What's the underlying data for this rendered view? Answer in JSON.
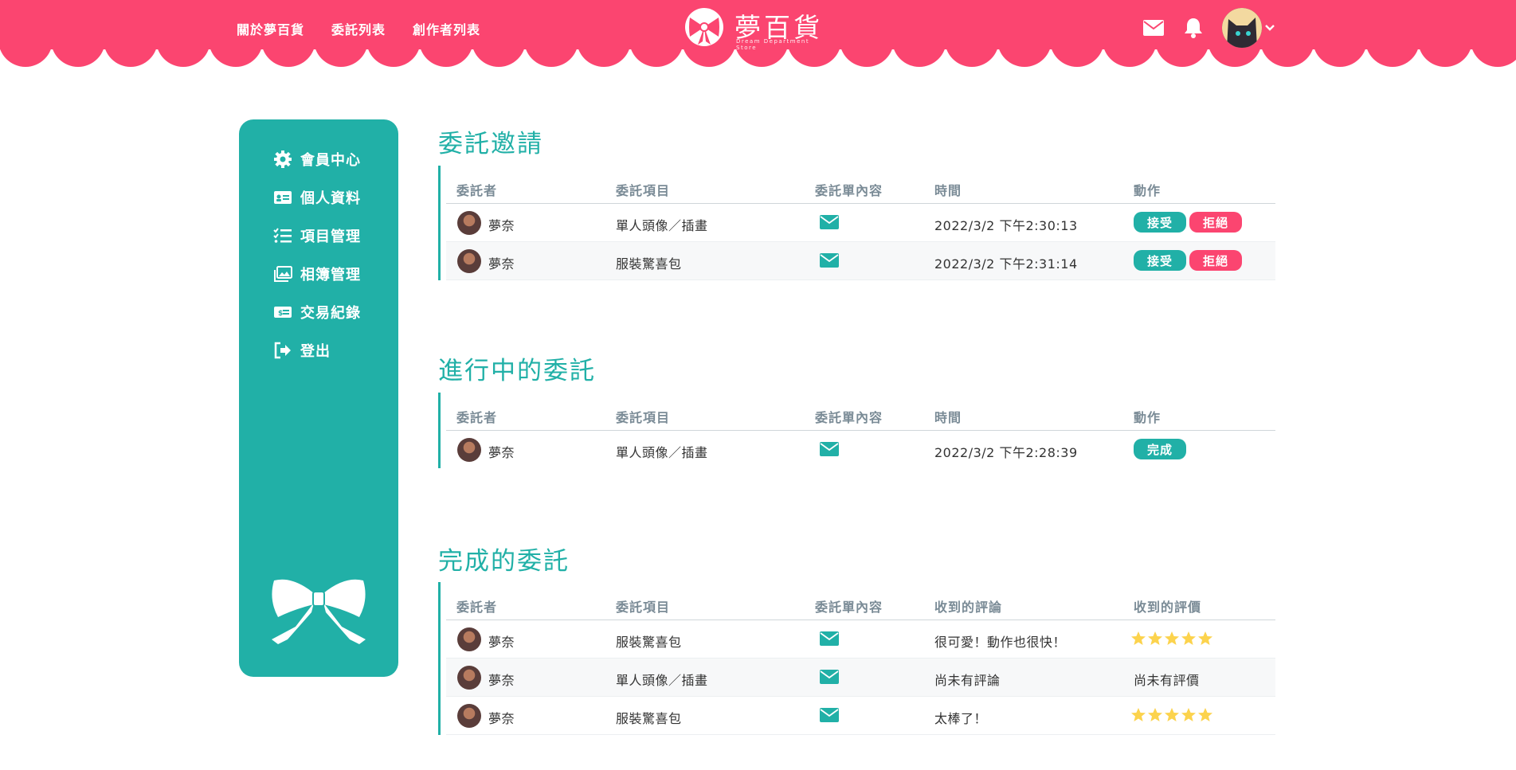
{
  "header": {
    "nav": [
      "關於夢百貨",
      "委託列表",
      "創作者列表"
    ],
    "logo_title": "夢百貨",
    "logo_subtitle": "Dream Department Store"
  },
  "sidebar": {
    "items": [
      {
        "label": "會員中心",
        "icon": "gear-icon"
      },
      {
        "label": "個人資料",
        "icon": "id-card-icon"
      },
      {
        "label": "項目管理",
        "icon": "tasks-icon"
      },
      {
        "label": "相簿管理",
        "icon": "images-icon"
      },
      {
        "label": "交易紀錄",
        "icon": "money-bill-icon"
      },
      {
        "label": "登出",
        "icon": "sign-out-icon"
      }
    ]
  },
  "sections": {
    "invites": {
      "title": "委託邀請",
      "headers": [
        "委託者",
        "委託項目",
        "委託單內容",
        "時間",
        "動作"
      ],
      "rows": [
        {
          "user": "夢奈",
          "item": "單人頭像／插畫",
          "time": "2022/3/2 下午2:30:13",
          "accept": "接受",
          "reject": "拒絕"
        },
        {
          "user": "夢奈",
          "item": "服裝驚喜包",
          "time": "2022/3/2 下午2:31:14",
          "accept": "接受",
          "reject": "拒絕"
        }
      ]
    },
    "ongoing": {
      "title": "進行中的委託",
      "headers": [
        "委託者",
        "委託項目",
        "委託單內容",
        "時間",
        "動作"
      ],
      "rows": [
        {
          "user": "夢奈",
          "item": "單人頭像／插畫",
          "time": "2022/3/2 下午2:28:39",
          "done": "完成"
        }
      ]
    },
    "completed": {
      "title": "完成的委託",
      "headers": [
        "委託者",
        "委託項目",
        "委託單內容",
        "收到的評論",
        "收到的評價"
      ],
      "rows": [
        {
          "user": "夢奈",
          "item": "服裝驚喜包",
          "comment": "很可愛！動作也很快！",
          "rating": 5,
          "rating_text": ""
        },
        {
          "user": "夢奈",
          "item": "單人頭像／插畫",
          "comment": "尚未有評論",
          "rating": 0,
          "rating_text": "尚未有評價"
        },
        {
          "user": "夢奈",
          "item": "服裝驚喜包",
          "comment": "太棒了！",
          "rating": 5,
          "rating_text": ""
        }
      ]
    }
  },
  "colors": {
    "primary": "#fb4570",
    "teal": "#21b0a7",
    "star": "#fcd34d"
  }
}
